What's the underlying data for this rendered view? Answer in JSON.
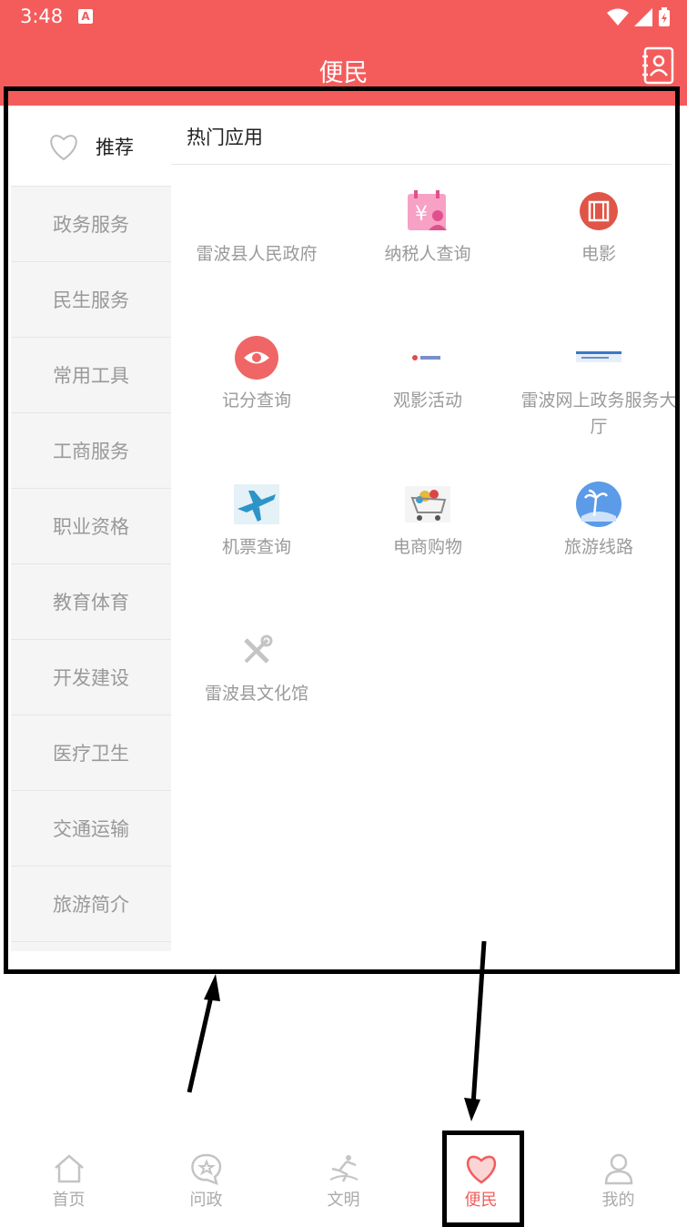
{
  "status": {
    "time": "3:48",
    "notif_letter": "A"
  },
  "header": {
    "title": "便民"
  },
  "sidebar": {
    "items": [
      {
        "label": "推荐"
      },
      {
        "label": "政务服务"
      },
      {
        "label": "民生服务"
      },
      {
        "label": "常用工具"
      },
      {
        "label": "工商服务"
      },
      {
        "label": "职业资格"
      },
      {
        "label": "教育体育"
      },
      {
        "label": "开发建设"
      },
      {
        "label": "医疗卫生"
      },
      {
        "label": "交通运输"
      },
      {
        "label": "旅游简介"
      }
    ]
  },
  "main": {
    "section_title": "热门应用",
    "apps": [
      {
        "label": "雷波县人民政府",
        "icon": "blank-icon"
      },
      {
        "label": "纳税人查询",
        "icon": "tax-calendar-icon"
      },
      {
        "label": "电影",
        "icon": "film-icon"
      },
      {
        "label": "记分查询",
        "icon": "eye-icon"
      },
      {
        "label": "观影活动",
        "icon": "banner-thumbnail-icon"
      },
      {
        "label": "雷波网上政务服务大厅",
        "icon": "blue-banner-icon"
      },
      {
        "label": "机票查询",
        "icon": "airplane-icon"
      },
      {
        "label": "电商购物",
        "icon": "shopping-cart-icon"
      },
      {
        "label": "旅游线路",
        "icon": "palm-tree-icon"
      },
      {
        "label": "雷波县文化馆",
        "icon": "tools-icon"
      }
    ]
  },
  "bottom_nav": {
    "items": [
      {
        "label": "首页"
      },
      {
        "label": "问政"
      },
      {
        "label": "文明"
      },
      {
        "label": "便民"
      },
      {
        "label": "我的"
      }
    ],
    "active_index": 3
  },
  "colors": {
    "brand": "#f45c5c",
    "annotation": "#000000"
  }
}
